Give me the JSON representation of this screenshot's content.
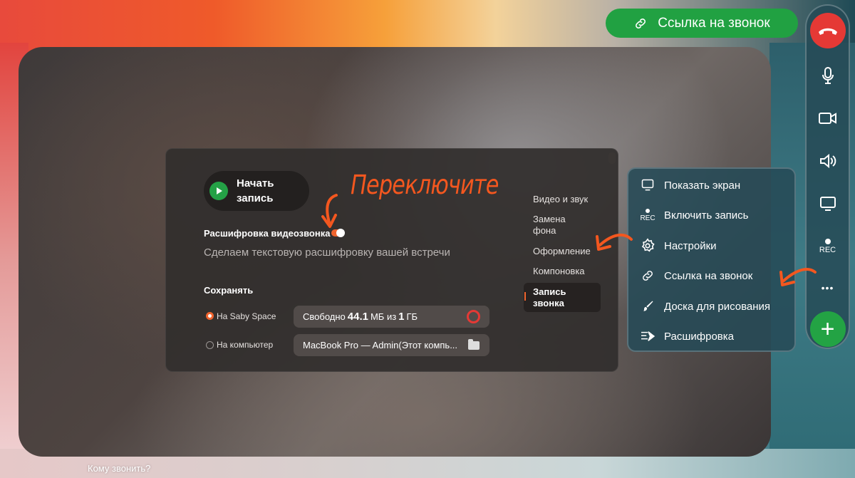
{
  "call_link_button": {
    "label": "Ссылка на звонок"
  },
  "sidebar": {
    "rec_label": "REC",
    "add_label": "+",
    "more_label": "•••"
  },
  "settings": {
    "start_recording_label": "Начать запись",
    "transcription": {
      "label": "Расшифровка видеозвонка",
      "enabled": true,
      "description": "Сделаем текстовую расшифровку вашей встречи"
    },
    "save": {
      "label": "Сохранять",
      "options": [
        {
          "label": "На Saby Space",
          "selected": true,
          "field_prefix": "Свободно",
          "free_value": "44.1",
          "free_unit": "МБ из",
          "total_value": "1",
          "total_unit": "ГБ"
        },
        {
          "label": "На компьютер",
          "selected": false,
          "field_text": "MacBook Pro — Admin(Этот компь..."
        }
      ]
    },
    "menu": [
      {
        "label": "Видео и звук"
      },
      {
        "label": "Замена фона"
      },
      {
        "label": "Оформление"
      },
      {
        "label": "Компоновка"
      },
      {
        "label": "Запись звонка",
        "active": true
      }
    ]
  },
  "context_menu": {
    "items": [
      {
        "label": "Показать экран",
        "icon": "screen-icon"
      },
      {
        "label": "Включить запись",
        "icon": "rec-icon",
        "icon_text": "REC"
      },
      {
        "label": "Настройки",
        "icon": "gear-icon"
      },
      {
        "label": "Ссылка на звонок",
        "icon": "link-icon"
      },
      {
        "label": "Доска для рисования",
        "icon": "brush-icon"
      },
      {
        "label": "Расшифровка",
        "icon": "transcribe-icon"
      }
    ]
  },
  "annotation": {
    "text": "Переключите",
    "color": "#f4571f"
  },
  "footer": {
    "who_to_call": "Кому звонить?"
  },
  "colors": {
    "accent_green": "#23a344",
    "hangup_red": "#e53935",
    "accent_orange": "#f0642e"
  }
}
